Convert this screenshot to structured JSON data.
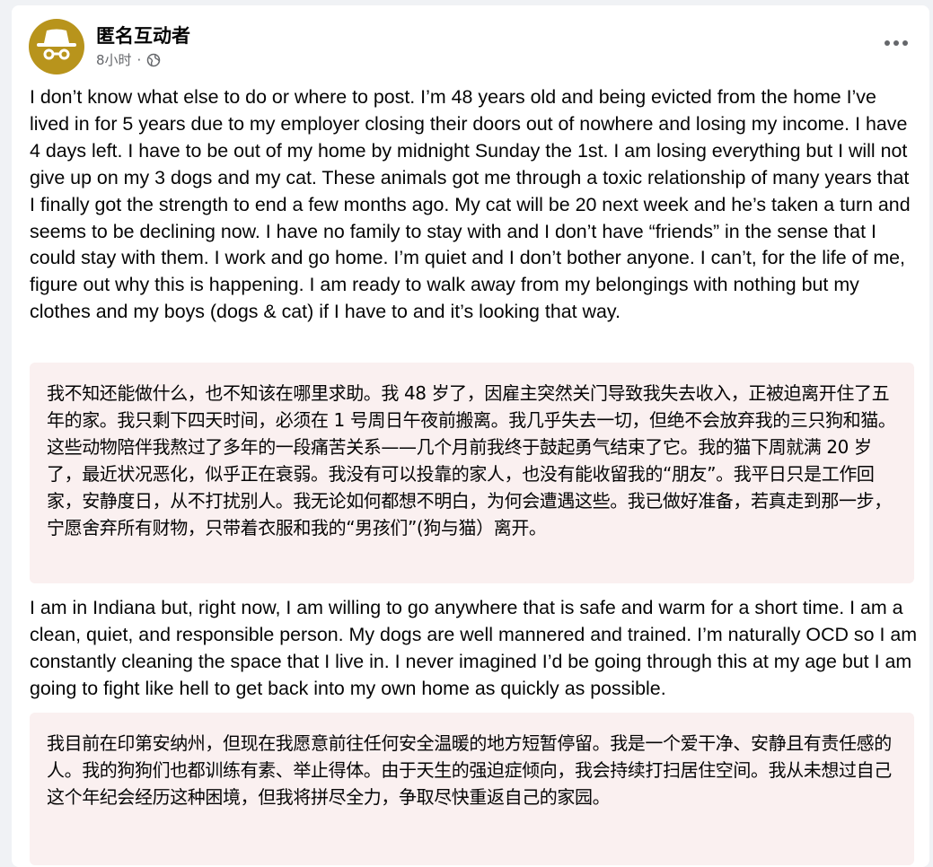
{
  "post": {
    "author": "匿名互动者",
    "time": "8小时",
    "separator": "·",
    "icons": {
      "avatar": "incognito-avatar-icon",
      "privacy": "globe-icon",
      "more": "more-options-icon"
    },
    "colors": {
      "avatar_bg": "#b8941c",
      "translation_bg": "#faf0f0",
      "meta_text": "#65676b"
    },
    "paragraphs": [
      "I don’t know what else to do or where to post. I’m 48 years old and being evicted from the home I’ve lived in for 5 years due to my employer closing their doors out of nowhere and losing my income. I have 4 days left. I have to be out of my home by midnight Sunday the 1st. I am losing everything but I will not give up on my 3 dogs and my cat. These animals got me through a toxic relationship of many years that I finally got the strength to end a few months ago. My cat will be 20 next week and he’s taken a turn and seems to be declining now. I have no family to stay with and I don’t have “friends” in the sense that I could stay with them. I work and go home. I’m quiet and I don’t bother anyone. I can’t, for the life of me, figure out why this is happening. I am ready to walk away from my belongings with nothing but my clothes and my boys (dogs & cat) if I have to and it’s looking that way.",
      "我不知还能做什么，也不知该在哪里求助。我 48 岁了，因雇主突然关门导致我失去收入，正被迫离开住了五年的家。我只剩下四天时间，必须在 1 号周日午夜前搬离。我几乎失去一切，但绝不会放弃我的三只狗和猫。这些动物陪伴我熬过了多年的一段痛苦关系——几个月前我终于鼓起勇气结束了它。我的猫下周就满 20 岁了，最近状况恶化，似乎正在衰弱。我没有可以投靠的家人，也没有能收留我的“朋友”。我平日只是工作回家，安静度日，从不打扰别人。我无论如何都想不明白，为何会遭遇这些。我已做好准备，若真走到那一步，宁愿舍弃所有财物，只带着衣服和我的“男孩们”(狗与猫）离开。",
      "I am in Indiana but, right now, I am willing to go anywhere that is safe and warm for a short time. I am a clean, quiet, and responsible person. My dogs are well mannered and trained. I’m naturally OCD so I am constantly cleaning the space that I live in. I never imagined I’d be going through this at my age but I am going to fight like hell to get back into my own home as quickly as possible.",
      "我目前在印第安纳州，但现在我愿意前往任何安全温暖的地方短暂停留。我是一个爱干净、安静且有责任感的人。我的狗狗们也都训练有素、举止得体。由于天生的强迫症倾向，我会持续打扫居住空间。我从未想过自己这个年纪会经历这种困境，但我将拼尽全力，争取尽快重返自己的家园。"
    ]
  }
}
